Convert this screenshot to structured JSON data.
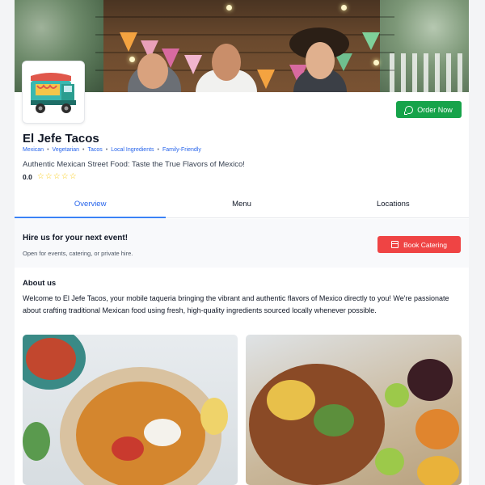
{
  "restaurant": {
    "name": "El Jefe Tacos",
    "tags": [
      "Mexican",
      "Vegetarian",
      "Tacos",
      "Local Ingredients",
      "Family-Friendly"
    ],
    "tag_separator": "•",
    "tagline": "Authentic Mexican Street Food: Taste the True Flavors of Mexico!",
    "rating_value": "0.0",
    "stars_filled": 0,
    "stars_total": 5
  },
  "actions": {
    "order_now": "Order Now",
    "book_catering": "Book Catering"
  },
  "tabs": [
    {
      "label": "Overview",
      "active": true
    },
    {
      "label": "Menu",
      "active": false
    },
    {
      "label": "Locations",
      "active": false
    }
  ],
  "hire": {
    "title": "Hire us for your next event!",
    "subtitle": "Open for events, catering, or private hire."
  },
  "about": {
    "heading": "About us",
    "body": "Welcome to El Jefe Tacos, your mobile taqueria bringing the vibrant and authentic flavors of Mexico directly to you! We're passionate about crafting traditional Mexican food using fresh, high-quality ingredients sourced locally whenever possible."
  },
  "colors": {
    "order_button": "#16a34a",
    "catering_button": "#ef4444",
    "link": "#2563eb",
    "star": "#facc15"
  },
  "icons": {
    "order_now": "whatsapp-chat-icon",
    "book_catering": "calendar-icon",
    "rating": "star-outline-icon"
  }
}
